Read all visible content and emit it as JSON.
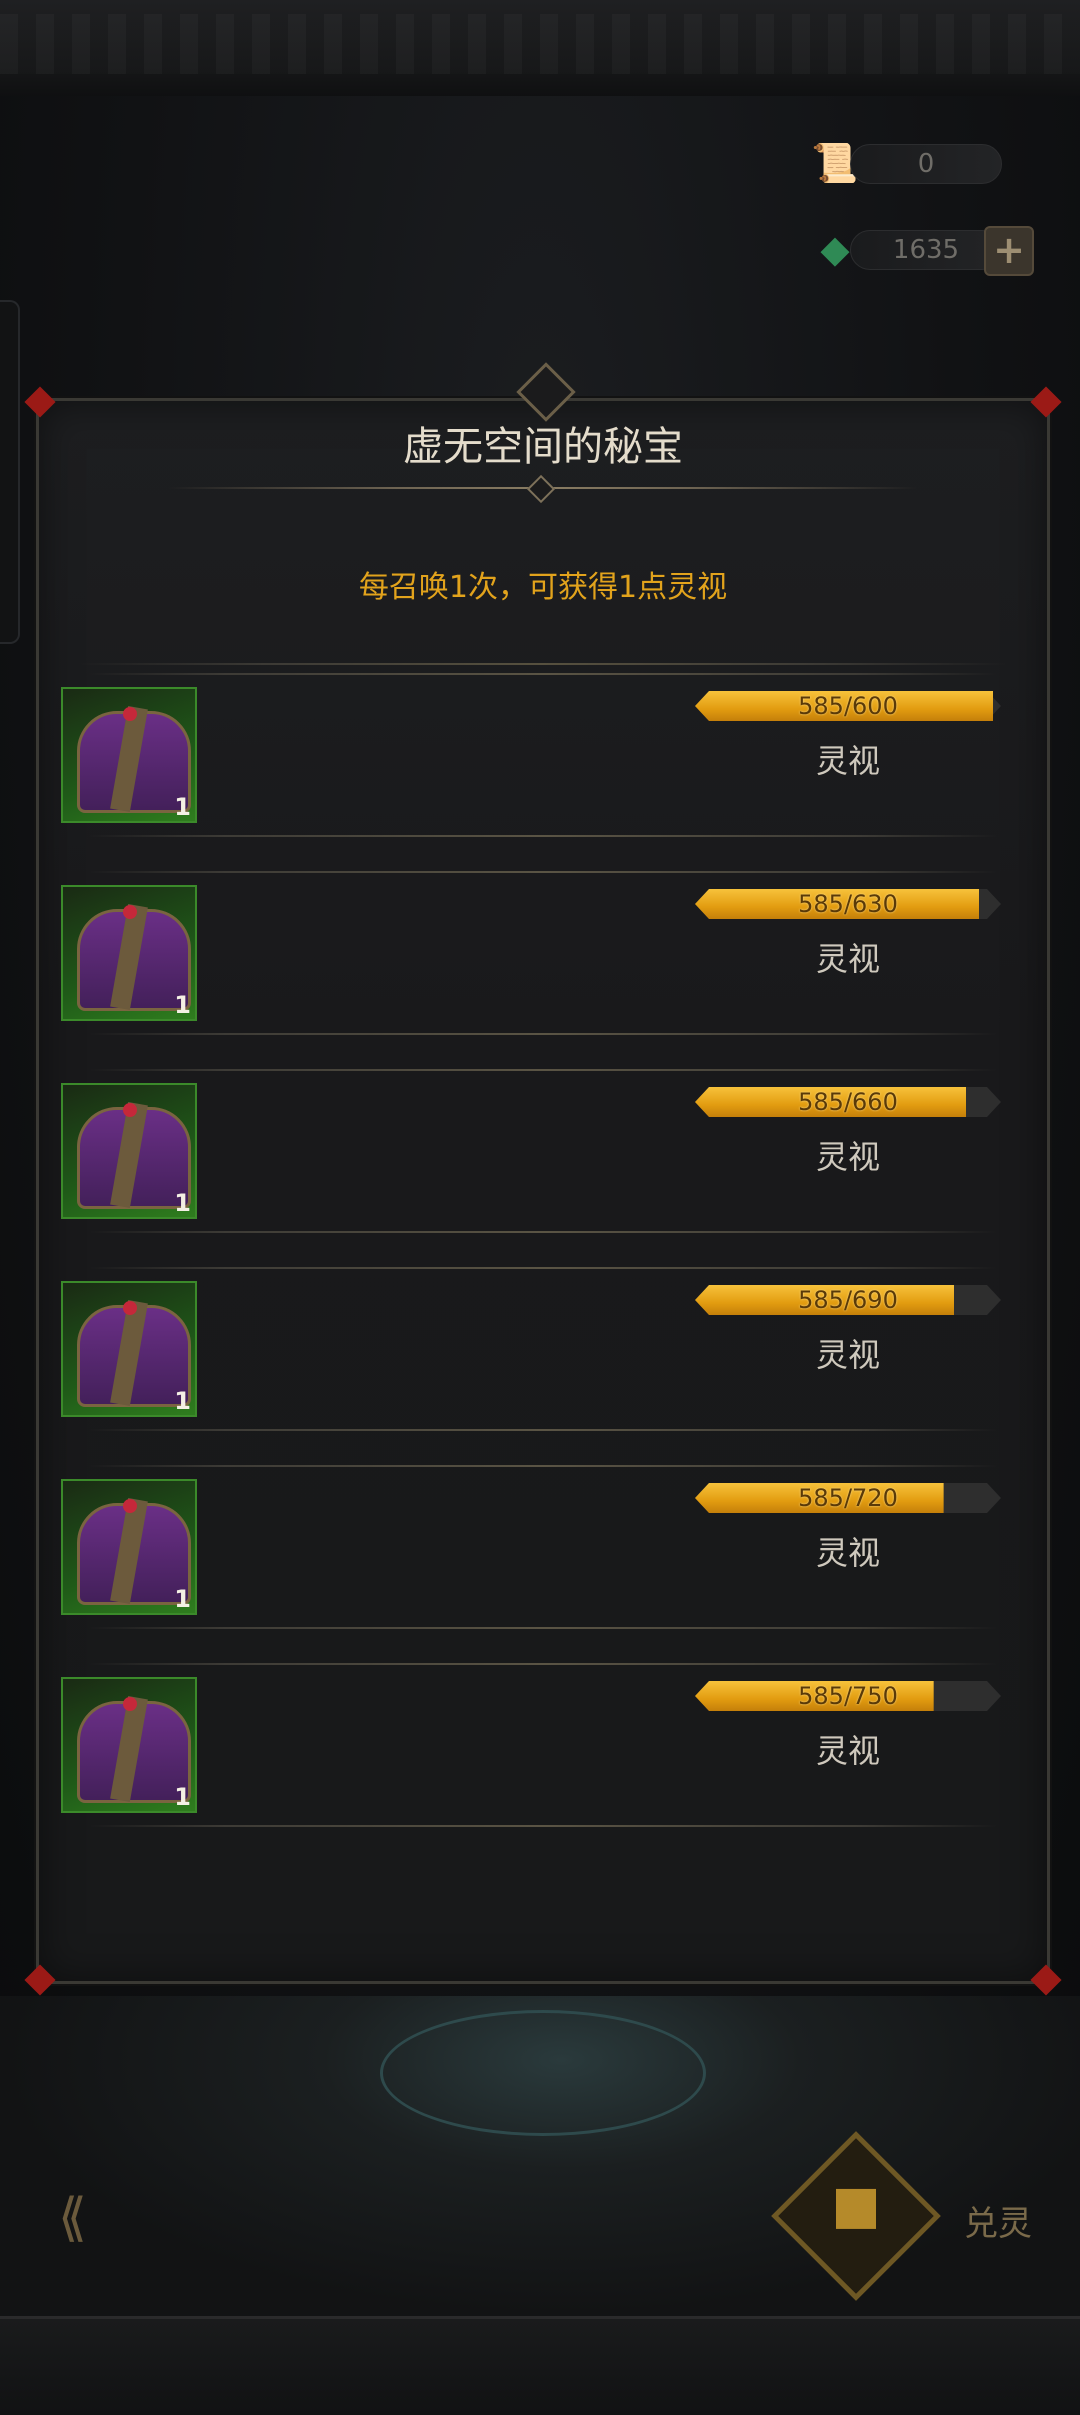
{
  "currency": {
    "scroll": {
      "icon": "scroll-icon",
      "value": "0"
    },
    "gem": {
      "icon": "green-crystal-icon",
      "value": "1635",
      "add_label": "+"
    }
  },
  "panel": {
    "title": "虚无空间的秘宝",
    "subtitle": "每召唤1次，可获得1点灵视"
  },
  "rewards": [
    {
      "count": "1",
      "progress": "585/600",
      "current": 585,
      "max": 600,
      "name": "灵视"
    },
    {
      "count": "1",
      "progress": "585/630",
      "current": 585,
      "max": 630,
      "name": "灵视"
    },
    {
      "count": "1",
      "progress": "585/660",
      "current": 585,
      "max": 660,
      "name": "灵视"
    },
    {
      "count": "1",
      "progress": "585/690",
      "current": 585,
      "max": 690,
      "name": "灵视"
    },
    {
      "count": "1",
      "progress": "585/720",
      "current": 585,
      "max": 720,
      "name": "灵视"
    },
    {
      "count": "1",
      "progress": "585/750",
      "current": 585,
      "max": 750,
      "name": "灵视"
    }
  ],
  "bottom": {
    "card_label": "兑灵"
  },
  "colors": {
    "accent": "#e2a31c",
    "bar_fill": "#f0b025",
    "chest_bg": "#2f7d1e",
    "corner": "#9b1a16"
  }
}
